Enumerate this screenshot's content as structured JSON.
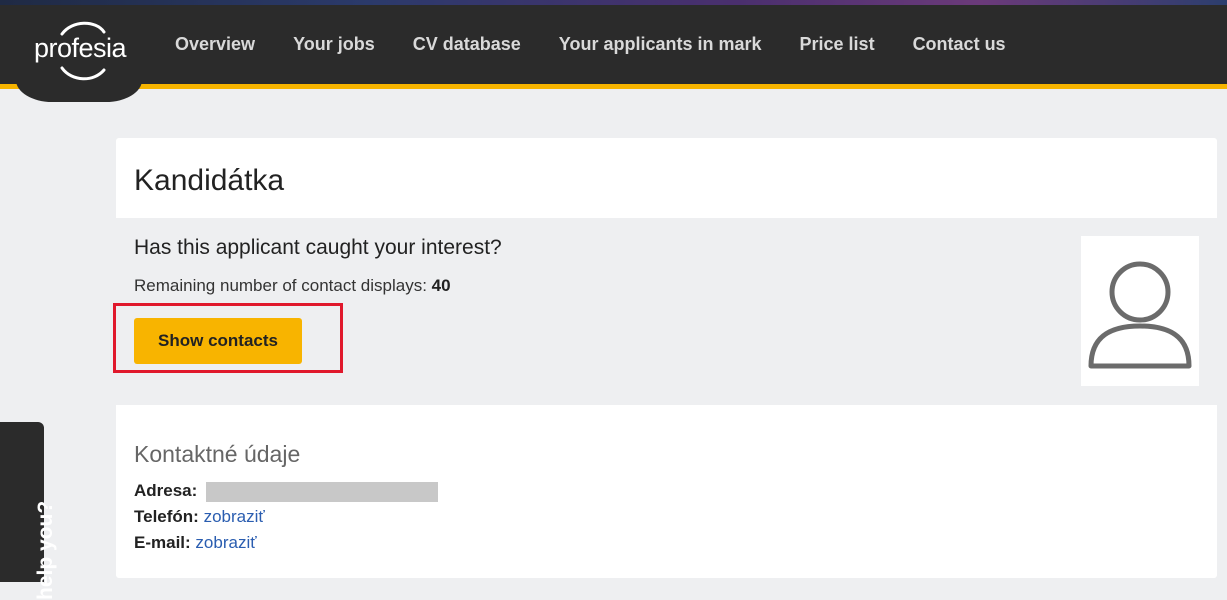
{
  "brand": {
    "logo_text": "profesia",
    "accent": "#f6b400",
    "nav_bg": "#2b2b2b"
  },
  "nav": {
    "items": [
      {
        "label": "Overview"
      },
      {
        "label": "Your jobs"
      },
      {
        "label": "CV database"
      },
      {
        "label": "Your applicants in mark"
      },
      {
        "label": "Price list"
      },
      {
        "label": "Contact us"
      }
    ]
  },
  "candidate": {
    "name": "Kandidátka"
  },
  "interest": {
    "heading": "Has this applicant caught your interest?",
    "remaining_label": "Remaining number of contact displays:",
    "remaining_count": "40",
    "show_contacts_label": "Show contacts"
  },
  "contact": {
    "heading": "Kontaktné údaje",
    "address_label": "Adresa:",
    "phone_label": "Telefón:",
    "phone_link": "zobraziť",
    "email_label": "E-mail:",
    "email_link": "zobraziť"
  },
  "help": {
    "label": "help you?"
  },
  "icons": {
    "avatar": "user-avatar-icon",
    "logo_swirl": "logo-swirl-icon"
  }
}
